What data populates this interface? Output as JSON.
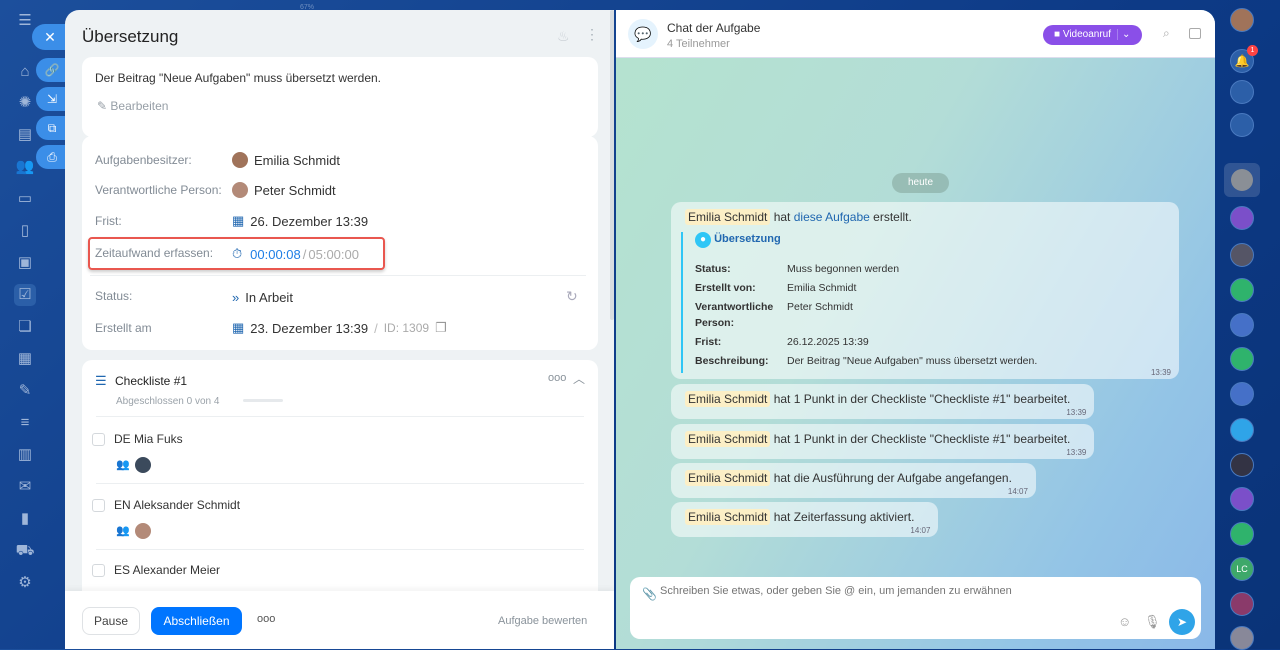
{
  "topbar": {
    "zoom": "67%"
  },
  "task": {
    "title": "Übersetzung",
    "description": "Der Beitrag \"Neue Aufgaben\" muss übersetzt werden.",
    "edit_label": "Bearbeiten",
    "fields": {
      "owner_label": "Aufgabenbesitzer:",
      "owner": "Emilia Schmidt",
      "responsible_label": "Verantwortliche Person:",
      "responsible": "Peter Schmidt",
      "deadline_label": "Frist:",
      "deadline": "26. Dezember 13:39",
      "time_label": "Zeitaufwand erfassen:",
      "time_spent": "00:00:08",
      "time_sep": "/",
      "time_planned": "05:00:00",
      "status_label": "Status:",
      "status": "In Arbeit",
      "created_label": "Erstellt am",
      "created": "23. Dezember 13:39",
      "id_sep": "/",
      "id": "ID: 1309"
    },
    "checklist": {
      "title": "Checkliste #1",
      "progress": "Abgeschlossen 0 von 4",
      "completed": 0,
      "total": 4,
      "items": [
        {
          "label": "DE Mia Fuks"
        },
        {
          "label": "EN Aleksander Schmidt"
        },
        {
          "label": "ES Alexander Meier"
        }
      ]
    },
    "footer": {
      "pause": "Pause",
      "complete": "Abschließen",
      "rate": "Aufgabe bewerten"
    }
  },
  "chat": {
    "title": "Chat der Aufgabe",
    "subtitle": "4 Teilnehmer",
    "video_label": "Videoanruf",
    "date_divider": "heute",
    "created_msg": {
      "name": "Emilia Schmidt",
      "pre": "hat",
      "link": "diese Aufgabe",
      "post": "erstellt.",
      "card_title": "Übersetzung",
      "rows": [
        [
          "Status:",
          "Muss begonnen werden"
        ],
        [
          "Erstellt von:",
          "Emilia Schmidt"
        ],
        [
          "Verantwortliche Person:",
          "Peter Schmidt"
        ],
        [
          "Frist:",
          "26.12.2025 13:39"
        ],
        [
          "Beschreibung:",
          "Der Beitrag \"Neue Aufgaben\" muss übersetzt werden."
        ]
      ],
      "time": "13:39"
    },
    "messages": [
      {
        "name": "Emilia Schmidt",
        "text": "hat 1 Punkt in der Checkliste \"Checkliste #1\" bearbeitet.",
        "time": "13:39"
      },
      {
        "name": "Emilia Schmidt",
        "text": "hat 1 Punkt in der Checkliste \"Checkliste #1\" bearbeitet.",
        "time": "13:39"
      },
      {
        "name": "Emilia Schmidt",
        "text": "hat die Ausführung der Aufgabe angefangen.",
        "time": "14:07"
      },
      {
        "name": "Emilia Schmidt",
        "text": "hat Zeiterfassung aktiviert.",
        "time": "14:07"
      }
    ],
    "input_placeholder": "Schreiben Sie etwas, oder geben Sie @ ein, um jemanden zu erwähnen"
  },
  "right_sidebar": {
    "notifications_badge": "1",
    "avatar_initials": "LC"
  },
  "colors": {
    "accent": "#0075ff",
    "video": "#8a4fe8",
    "highlight": "#e9574f"
  }
}
